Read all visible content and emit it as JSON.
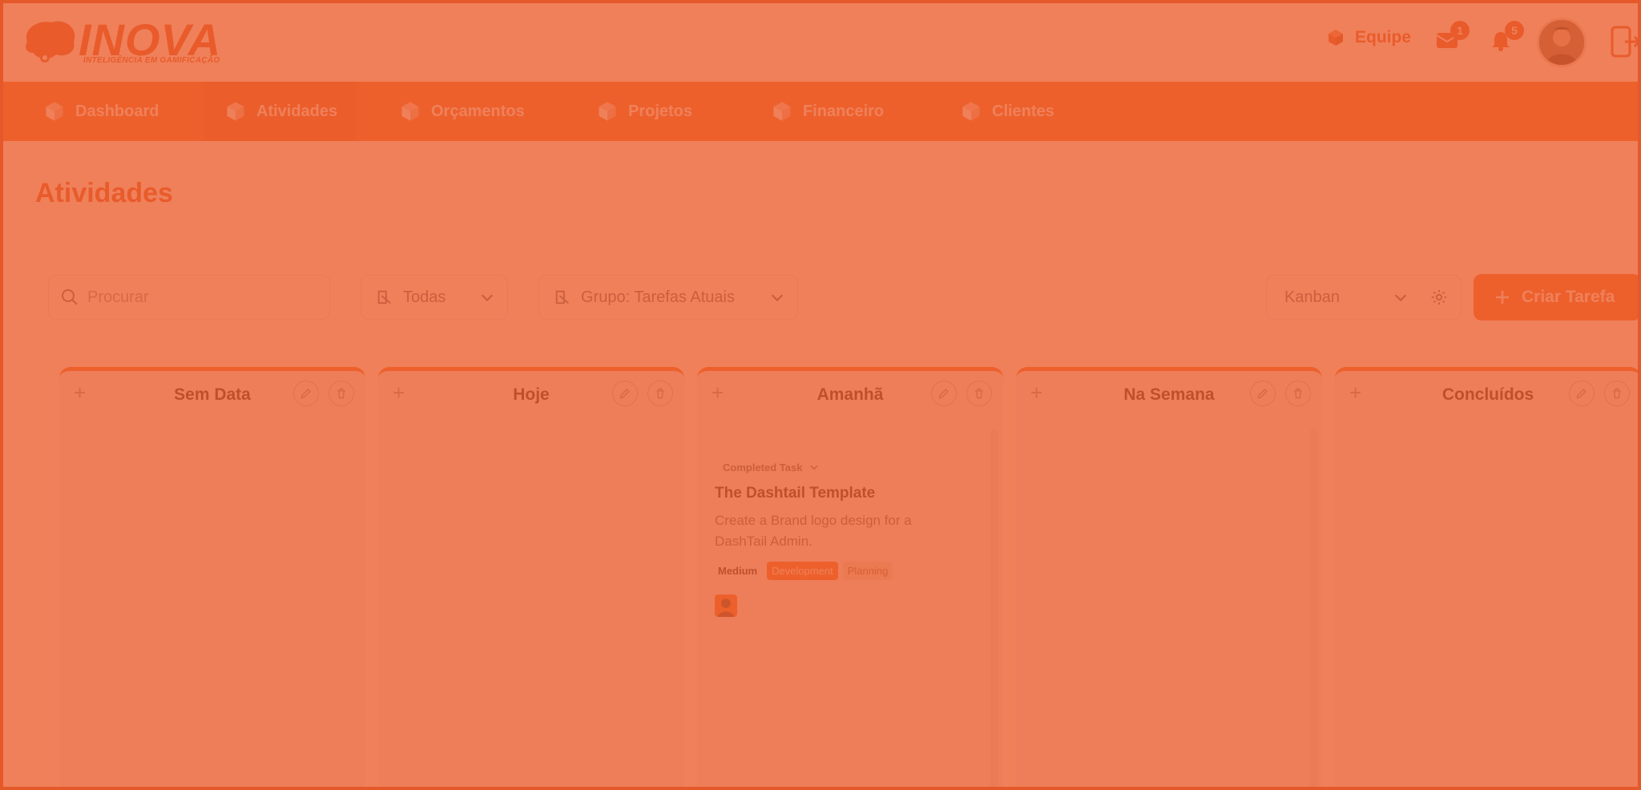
{
  "colors": {
    "brand": "#e3582b",
    "nav": "#f3702f",
    "overlay": "#ea5c2c"
  },
  "header": {
    "logo_text": "INOVA",
    "logo_tagline": "INTELIGÊNCIA EM GAMIFICAÇÃO",
    "team_label": "Equipe",
    "messages_badge": "1",
    "notifications_badge": "5"
  },
  "nav": {
    "items": [
      {
        "label": "Dashboard",
        "icon": "cube-icon"
      },
      {
        "label": "Atividades",
        "icon": "cube-icon",
        "active": true
      },
      {
        "label": "Orçamentos",
        "icon": "cube-icon"
      },
      {
        "label": "Projetos",
        "icon": "cube-icon"
      },
      {
        "label": "Financeiro",
        "icon": "cube-icon"
      },
      {
        "label": "Clientes",
        "icon": "cube-icon"
      }
    ]
  },
  "page": {
    "title": "Atividades"
  },
  "toolbar": {
    "search_placeholder": "Procurar",
    "filter_value": "Todas",
    "group_value": "Grupo: Tarefas Atuais",
    "view_value": "Kanban",
    "create_label": "Criar Tarefa"
  },
  "columns": [
    {
      "title": "Sem Data",
      "add": "+"
    },
    {
      "title": "Hoje",
      "add": "+"
    },
    {
      "title": "Amanhã",
      "add": "+"
    },
    {
      "title": "Na Semana",
      "add": "+"
    },
    {
      "title": "Concluídos",
      "add": "+"
    }
  ],
  "card": {
    "status": "Completed Task",
    "title": "The Dashtail Template",
    "description": "Create a Brand logo design for a DashTail Admin.",
    "priority": "Medium",
    "tags": [
      "Development",
      "Planning"
    ]
  }
}
